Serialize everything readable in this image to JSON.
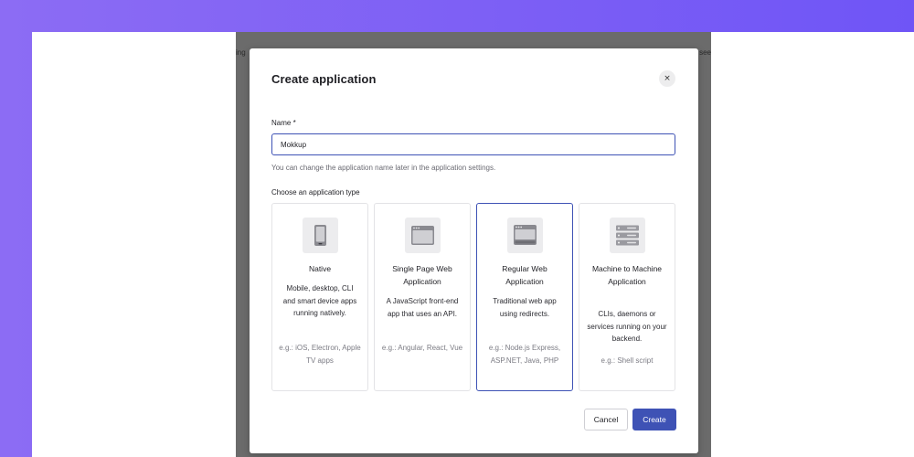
{
  "background": {
    "gradient_start": "#8c6cf4",
    "gradient_end": "#6f55f6",
    "overlay": "#6b6b6b"
  },
  "peek": {
    "left_text": "ing",
    "right_text": "see"
  },
  "modal": {
    "title": "Create application",
    "close_icon": "×",
    "name_label": "Name *",
    "name_value": "Mokkup",
    "help_text": "You can change the application name later in the application settings.",
    "type_label": "Choose an application type",
    "cards": [
      {
        "title": "Native",
        "description": "Mobile, desktop, CLI and smart device apps running natively.",
        "example": "e.g.: iOS, Electron, Apple TV apps",
        "icon": "mobile-device-icon",
        "selected": false
      },
      {
        "title": "Single Page Web Application",
        "description": "A JavaScript front-end app that uses an API.",
        "example": "e.g.: Angular, React, Vue",
        "icon": "browser-window-icon",
        "selected": false
      },
      {
        "title": "Regular Web Application",
        "description": "Traditional web app using redirects.",
        "example": "e.g.: Node.js Express, ASP.NET, Java, PHP",
        "icon": "server-browser-icon",
        "selected": true
      },
      {
        "title": "Machine to Machine Application",
        "description": "CLIs, daemons or services running on your backend.",
        "example": "e.g.: Shell script",
        "icon": "server-rack-icon",
        "selected": false
      }
    ],
    "cancel_label": "Cancel",
    "create_label": "Create",
    "accent_color": "#3e52b5"
  }
}
